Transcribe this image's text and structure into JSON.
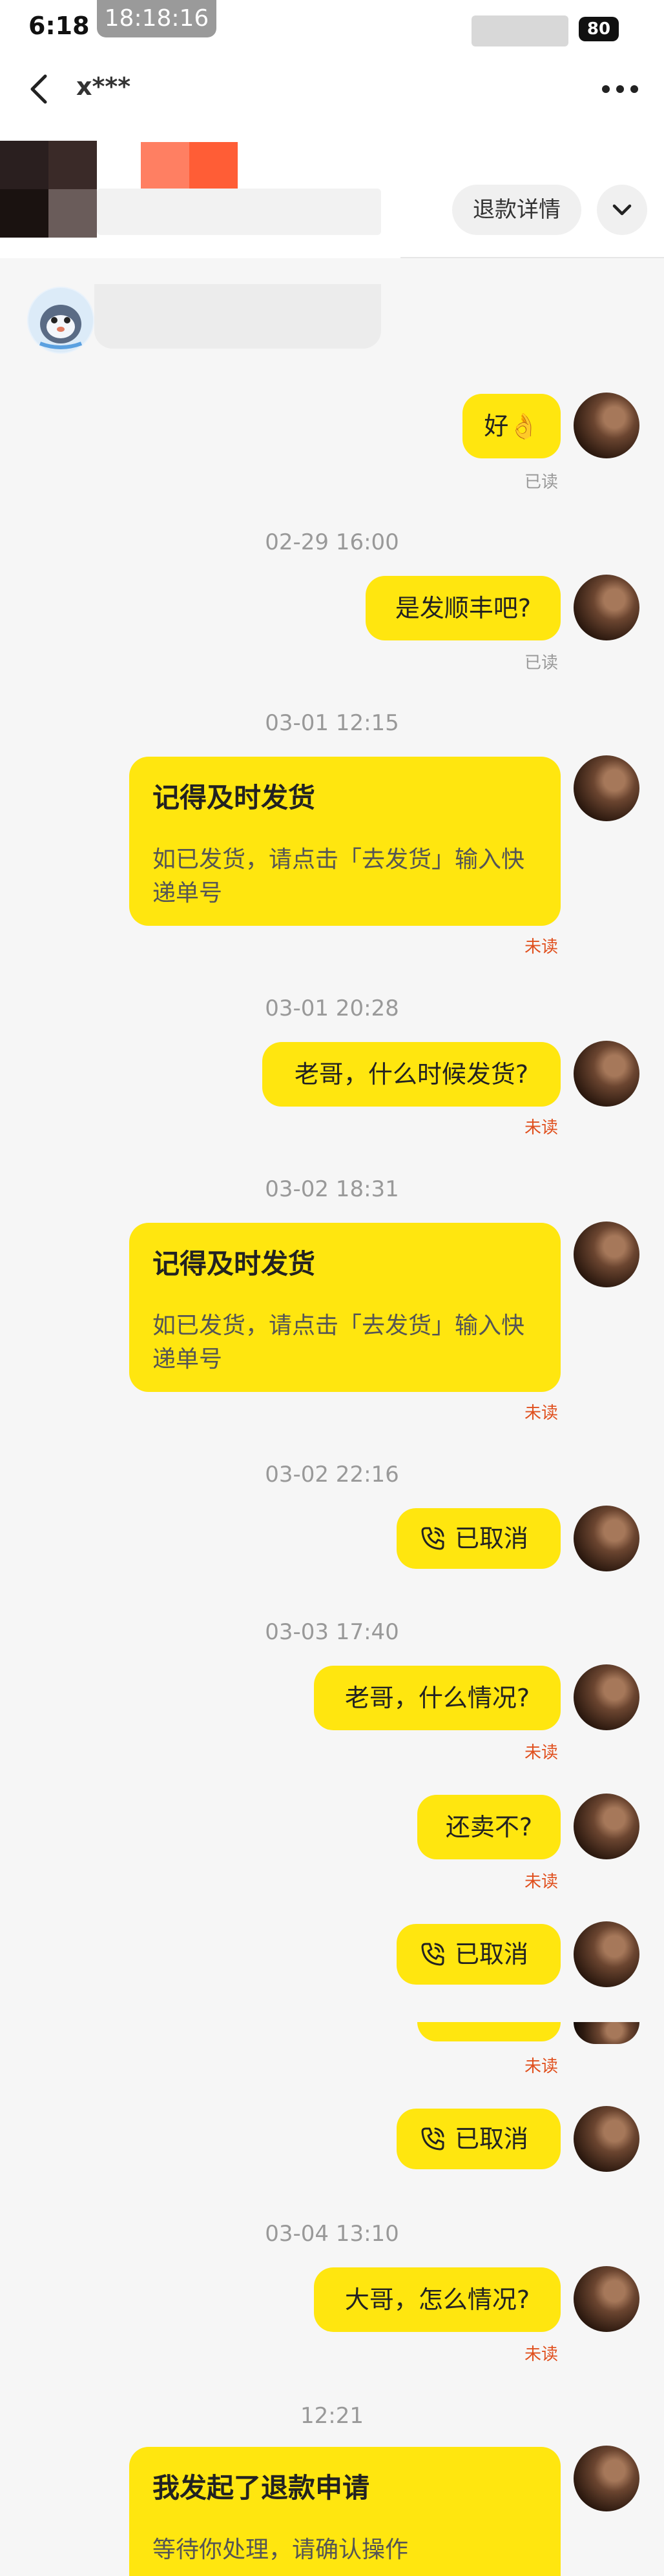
{
  "status_bar": {
    "time": "6:18",
    "recording_time": "18:18:16",
    "battery": "80"
  },
  "header": {
    "contact_name": "x***",
    "refund_button": "退款详情",
    "dropdown_icon": "chevron-down-icon",
    "back_icon": "chevron-left-icon",
    "more_icon": "more-horizontal-icon"
  },
  "colors": {
    "bubble": "#ffe60f",
    "unread": "#e0501e",
    "read": "#999999",
    "background": "#f6f6f6"
  },
  "messages": [
    {
      "type": "text",
      "text": "好👌",
      "status": "已读"
    },
    {
      "type": "timestamp",
      "text": "02-29 16:00"
    },
    {
      "type": "text",
      "text": "是发顺丰吧?",
      "status": "已读"
    },
    {
      "type": "timestamp",
      "text": "03-01 12:15"
    },
    {
      "type": "card",
      "title": "记得及时发货",
      "body": "如已发货，请点击「去发货」输入快递单号",
      "status": "未读"
    },
    {
      "type": "timestamp",
      "text": "03-01 20:28"
    },
    {
      "type": "text",
      "text": "老哥，什么时候发货?",
      "status": "未读"
    },
    {
      "type": "timestamp",
      "text": "03-02 18:31"
    },
    {
      "type": "card",
      "title": "记得及时发货",
      "body": "如已发货，请点击「去发货」输入快递单号",
      "status": "未读"
    },
    {
      "type": "timestamp",
      "text": "03-02 22:16"
    },
    {
      "type": "call",
      "text": "已取消"
    },
    {
      "type": "timestamp",
      "text": "03-03 17:40"
    },
    {
      "type": "text",
      "text": "老哥，什么情况?",
      "status": "未读"
    },
    {
      "type": "text",
      "text": "还卖不?",
      "status": "未读"
    },
    {
      "type": "call",
      "text": "已取消"
    },
    {
      "type": "status_only",
      "status": "未读"
    },
    {
      "type": "call",
      "text": "已取消"
    },
    {
      "type": "timestamp",
      "text": "03-04 13:10"
    },
    {
      "type": "text",
      "text": "大哥，怎么情况?",
      "status": "未读"
    },
    {
      "type": "timestamp",
      "text": "12:21"
    },
    {
      "type": "card",
      "title": "我发起了退款申请",
      "body": "等待你处理，请确认操作"
    }
  ]
}
